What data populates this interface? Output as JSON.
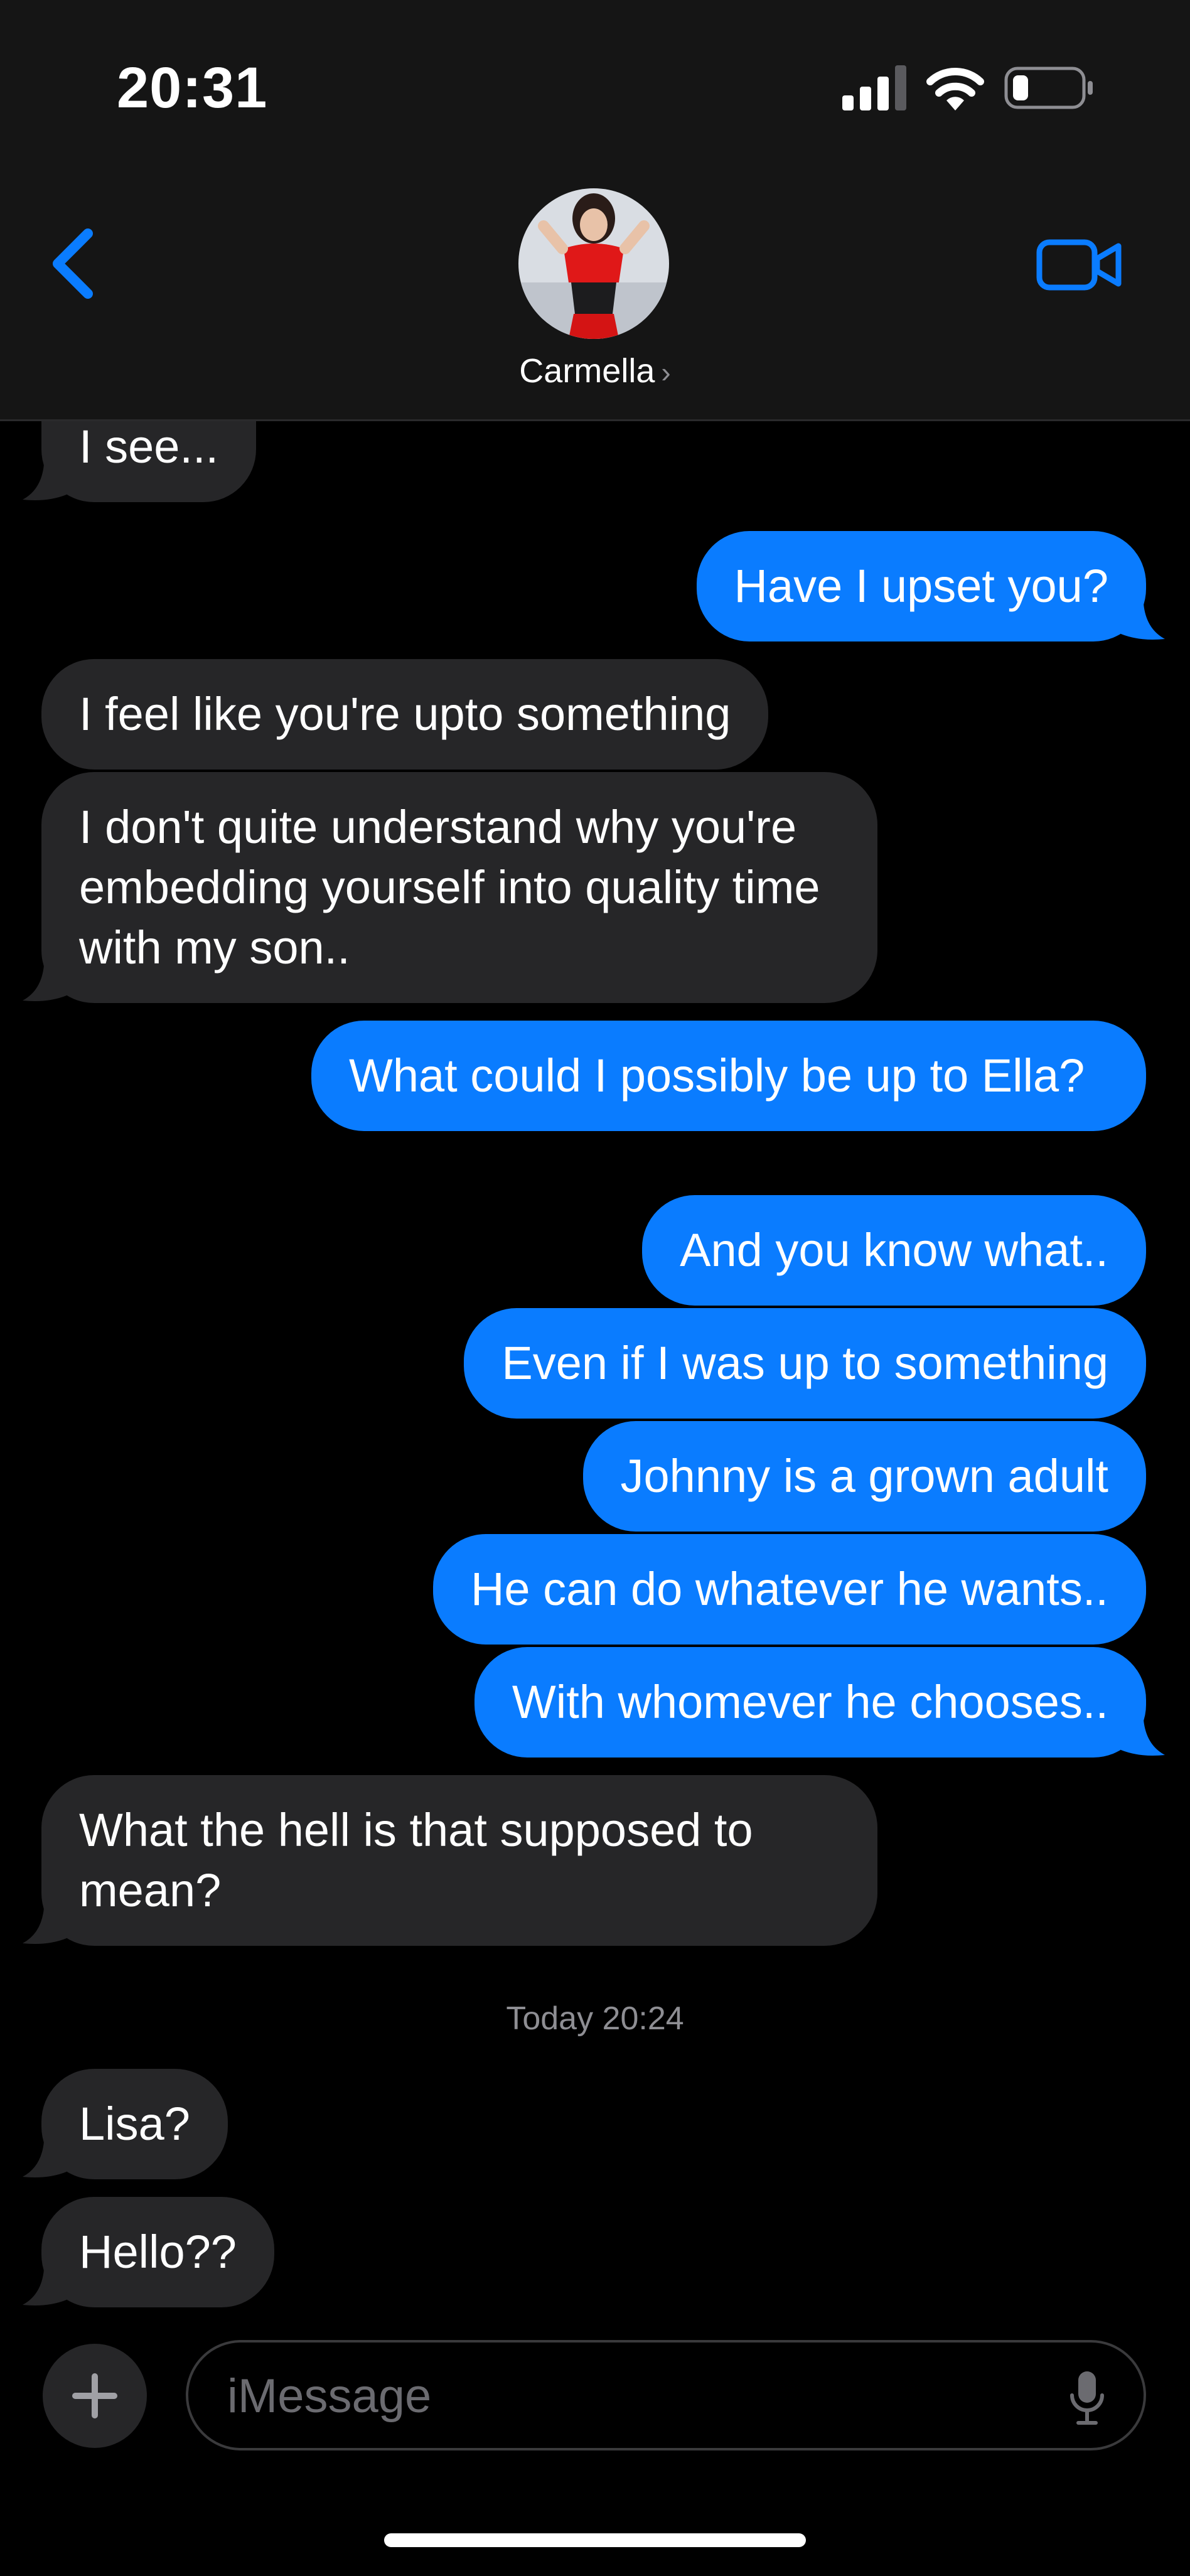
{
  "status_bar": {
    "time": "20:31"
  },
  "header": {
    "contact_name": "Carmella",
    "chevron": "›",
    "back_icon": "chevron-left-icon",
    "call_icon": "video-camera-icon",
    "accent_color": "#0a7cff"
  },
  "messages": [
    {
      "direction": "incoming",
      "text": "I see..."
    },
    {
      "direction": "outgoing",
      "text": "Have I upset you?"
    },
    {
      "direction": "incoming",
      "text": "I feel like you're upto something"
    },
    {
      "direction": "incoming",
      "text": "I don't quite understand why you're embedding yourself into quality time with my son.."
    },
    {
      "direction": "outgoing",
      "text": "What could I possibly be up to Ella?"
    },
    {
      "direction": "outgoing",
      "text": "And you know what.."
    },
    {
      "direction": "outgoing",
      "text": "Even if I was up to something"
    },
    {
      "direction": "outgoing",
      "text": "Johnny is a grown adult"
    },
    {
      "direction": "outgoing",
      "text": "He can do whatever he wants.."
    },
    {
      "direction": "outgoing",
      "text": "With whomever he chooses.."
    },
    {
      "direction": "incoming",
      "text": "What the hell is that supposed to mean?"
    },
    {
      "direction": "incoming",
      "text": "Lisa?"
    },
    {
      "direction": "incoming",
      "text": "Hello??"
    }
  ],
  "timestamp": "Today 20:24",
  "composer": {
    "placeholder": "iMessage",
    "plus_label": "+"
  },
  "colors": {
    "outgoing_bubble": "#0a7cff",
    "incoming_bubble": "#262628",
    "background": "#000000"
  }
}
